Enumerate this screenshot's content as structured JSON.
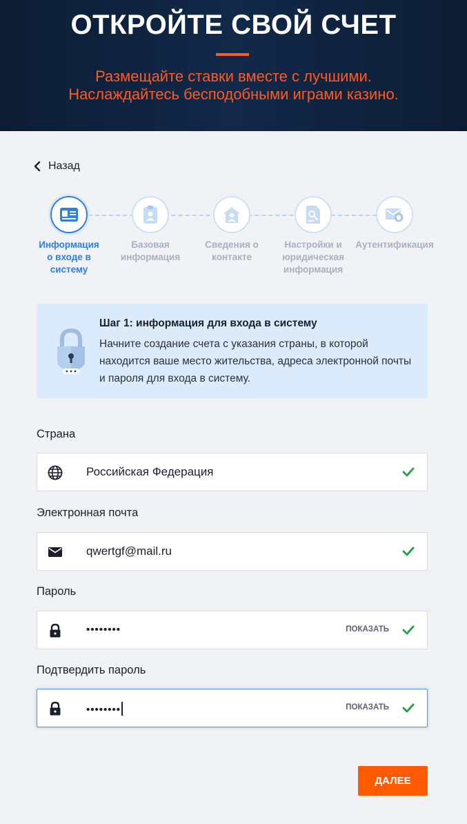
{
  "hero": {
    "title": "ОТКРОЙТЕ СВОЙ СЧЕТ",
    "subtitle_line1": "Размещайте ставки вместе с лучшими.",
    "subtitle_line2": "Наслаждайтесь бесподобными играми казино."
  },
  "nav": {
    "back_label": "Назад",
    "back_icon": "chevron-left-icon"
  },
  "steps": [
    {
      "icon": "id-card-icon",
      "line1": "Информация",
      "line2": "о входе в",
      "line3": "систему",
      "active": true
    },
    {
      "icon": "clipboard-user-icon",
      "line1": "Базовая",
      "line2": "информация",
      "line3": "",
      "active": false
    },
    {
      "icon": "house-user-icon",
      "line1": "Сведения о",
      "line2": "контакте",
      "line3": "",
      "active": false
    },
    {
      "icon": "document-settings-icon",
      "line1": "Настройки и",
      "line2": "юридическая",
      "line3": "информация",
      "active": false
    },
    {
      "icon": "envelope-shield-icon",
      "line1": "Аутентификация",
      "line2": "",
      "line3": "",
      "active": false
    }
  ],
  "info": {
    "icon": "padlock-icon",
    "title": "Шаг 1: информация для входа в систему",
    "text": "Начните создание счета с указания страны, в которой находится ваше место жительства, адреса электронной почты и пароля для входа в систему."
  },
  "form": {
    "country": {
      "label": "Страна",
      "value": "Российская Федерация",
      "icon": "globe-icon",
      "valid": true
    },
    "email": {
      "label": "Электронная почта",
      "value": "qwertgf@mail.ru",
      "icon": "envelope-icon",
      "valid": true
    },
    "password": {
      "label": "Пароль",
      "value": "••••••••",
      "icon": "lock-icon",
      "show_label": "ПОКАЗАТЬ",
      "valid": true
    },
    "confirm": {
      "label": "Подтвердить пароль",
      "value": "••••••••",
      "icon": "lock-icon",
      "show_label": "ПОКАЗАТЬ",
      "valid": true
    }
  },
  "actions": {
    "next_label": "ДАЛЕЕ"
  },
  "colors": {
    "accent": "#ff5a00",
    "primary": "#2f7fe0",
    "hero_bg": "#0c1c33",
    "valid": "#2aa14a"
  }
}
